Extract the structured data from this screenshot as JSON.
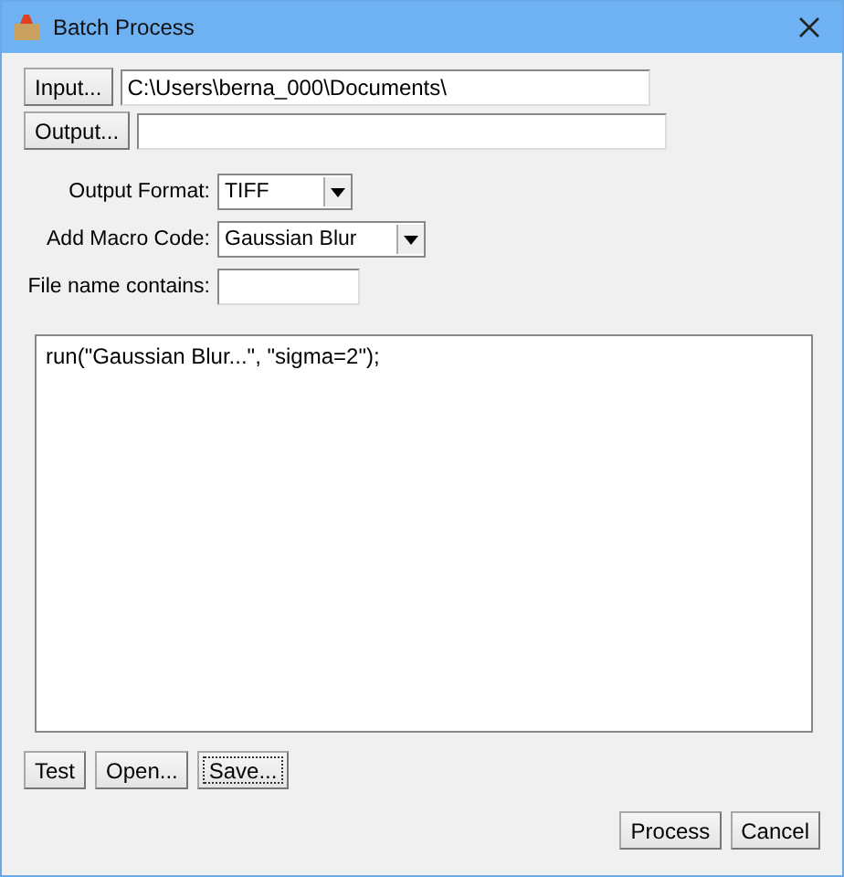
{
  "window": {
    "title": "Batch Process"
  },
  "input": {
    "button": "Input...",
    "value": "C:\\Users\\berna_000\\Documents\\"
  },
  "output": {
    "button": "Output..."
  },
  "options": [
    {
      "kind": "combo",
      "label": "Output Format:",
      "value": "TIFF"
    },
    {
      "kind": "combo",
      "label": "Add Macro Code:",
      "value": "Gaussian Blur"
    },
    {
      "kind": "text",
      "label": "File name contains:"
    }
  ],
  "macro_code": "run(\"Gaussian Blur...\", \"sigma=2\");",
  "macro_buttons": [
    {
      "label": "Test",
      "focused": false
    },
    {
      "label": "Open...",
      "focused": false
    },
    {
      "label": "Save...",
      "focused": true
    }
  ],
  "dialog_buttons": [
    {
      "label": "Process",
      "focused": false
    },
    {
      "label": "Cancel",
      "focused": false
    }
  ]
}
